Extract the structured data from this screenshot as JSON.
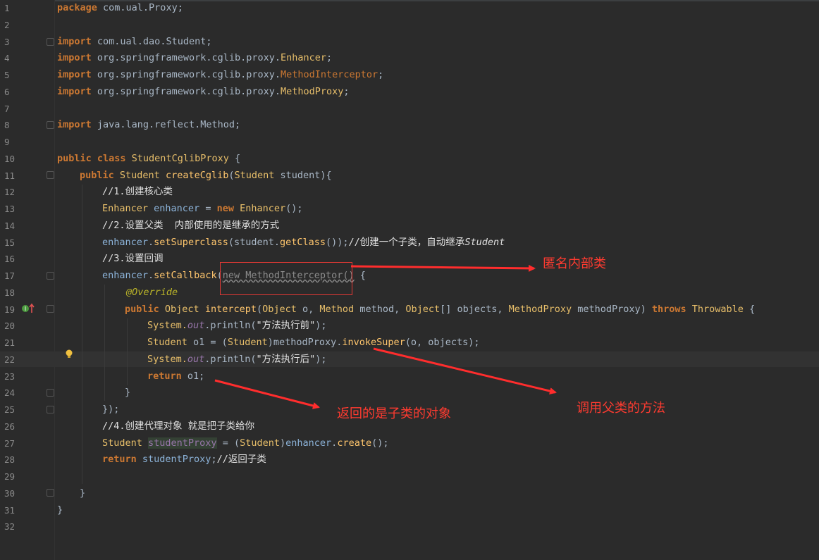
{
  "editor": {
    "line_numbers": [
      "1",
      "2",
      "3",
      "4",
      "5",
      "6",
      "7",
      "8",
      "9",
      "10",
      "11",
      "12",
      "13",
      "14",
      "15",
      "16",
      "17",
      "18",
      "19",
      "20",
      "21",
      "22",
      "23",
      "24",
      "25",
      "26",
      "27",
      "28",
      "29",
      "30",
      "31",
      "32"
    ]
  },
  "code": {
    "l1_kw": "package",
    "l1_rest": " com.ual.Proxy;",
    "l3_kw": "import",
    "l3_rest": " com.ual.dao.Student;",
    "l4_kw": "import",
    "l4_pkg": " org.springframework.cglib.proxy.",
    "l4_cls": "Enhancer",
    "l4_end": ";",
    "l5_kw": "import",
    "l5_pkg": " org.springframework.cglib.proxy.",
    "l5_cls": "MethodInterceptor",
    "l5_end": ";",
    "l6_kw": "import",
    "l6_pkg": " org.springframework.cglib.proxy.",
    "l6_cls": "MethodProxy",
    "l6_end": ";",
    "l8_kw": "import",
    "l8_rest": " java.lang.reflect.Method;",
    "l10_kw": "public class ",
    "l10_cls": "StudentCglibProxy",
    "l10_rest": " {",
    "l11_kw": "public ",
    "l11_type": "Student ",
    "l11_fn": "createCglib",
    "l11_p1": "(",
    "l11_ptype": "Student",
    "l11_rest": " student){",
    "l12": "//1.创建核心类",
    "l13_type": "Enhancer ",
    "l13_var": "enhancer",
    "l13_eq": " = ",
    "l13_new": "new ",
    "l13_cls": "Enhancer",
    "l13_end": "();",
    "l14": "//2.设置父类  内部使用的是继承的方式",
    "l15_var": "enhancer",
    "l15_dot": ".",
    "l15_fn": "setSuperclass",
    "l15_mid": "(student.",
    "l15_fn2": "getClass",
    "l15_end": "());",
    "l15_cm": "//创建一个子类，自动继承",
    "l15_cm_i": "Student",
    "l16": "//3.设置回调",
    "l17_var": "enhancer",
    "l17_dot": ".",
    "l17_fn": "setCallback",
    "l17_p": "(",
    "l17_anon": "new MethodInterceptor()",
    "l17_end": " {",
    "l18": "@Override",
    "l19_kw": "public ",
    "l19_type": "Object ",
    "l19_fn": "intercept",
    "l19_p1": "(",
    "l19_t1": "Object",
    "l19_a1": " o, ",
    "l19_t2": "Method",
    "l19_a2": " method, ",
    "l19_t3": "Object",
    "l19_a3": "[] objects, ",
    "l19_t4": "MethodProxy",
    "l19_a4": " methodProxy) ",
    "l19_throws": "throws ",
    "l19_ex": "Throwable",
    "l19_end": " {",
    "l20_cls": "System.",
    "l20_fld": "out",
    "l20_mid": ".println(",
    "l20_str": "\"方法执行前\"",
    "l20_end": ");",
    "l21_type": "Student",
    "l21_var": " o1 = (",
    "l21_cast": "Student",
    "l21_mid": ")methodProxy.",
    "l21_fn": "invokeSuper",
    "l21_end": "(o, objects);",
    "l22_cls": "System.",
    "l22_fld": "out",
    "l22_mid": ".println(",
    "l22_str": "\"方法执行后\"",
    "l22_end": ");",
    "l23_kw": "return ",
    "l23_rest": "o1;",
    "l24": "}",
    "l25": "});",
    "l26": "//4.创建代理对象 就是把子类给你",
    "l27_type": "Student ",
    "l27_var": "studentProxy",
    "l27_mid": " = (",
    "l27_cast": "Student",
    "l27_p": ")",
    "l27_enh": "enhancer",
    "l27_dot": ".",
    "l27_fn": "create",
    "l27_end": "();",
    "l28_kw": "return ",
    "l28_var": "studentProxy",
    "l28_end": ";",
    "l28_cm": "//返回子类",
    "l30": "}",
    "l31": "}"
  },
  "annotations": {
    "anonymous_class": "匿名内部类",
    "return_subclass": "返回的是子类的对象",
    "call_parent": "调用父类的方法"
  },
  "colors": {
    "background": "#2b2b2b",
    "keyword": "#cc7832",
    "string": "#6a8759",
    "annotation_red": "#ff3b30"
  }
}
